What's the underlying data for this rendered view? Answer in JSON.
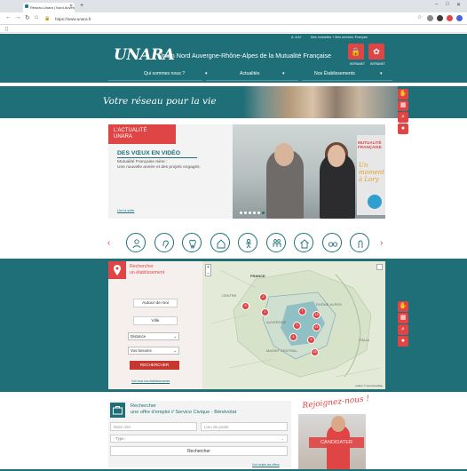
{
  "browser": {
    "tab_title": "Réseau Unara | Nord Auvergne",
    "url": "https://www.unara.fr",
    "nav_icons": [
      "back-arrow-icon",
      "forward-arrow-icon",
      "reload-icon",
      "home-icon"
    ],
    "window_controls": [
      "–",
      "□",
      "✕"
    ]
  },
  "header": {
    "toplinks": [
      "A- A A+",
      "Mes mutuelles + Mes services +",
      "Français"
    ],
    "logo": "UNARA",
    "title": "Union Nord Auvergne-Rhône-Alpes de la Mutualité Française",
    "buttons": [
      {
        "icon": "lock-icon",
        "label": "INTRANET"
      },
      {
        "icon": "network-icon",
        "label": "INTRANET"
      }
    ],
    "menu": [
      "Qui sommes nous ?",
      "Actualités",
      "Nos Établissements"
    ],
    "accent": "#e04545",
    "brand": "#1f6f78"
  },
  "hero": {
    "slogan": "Votre réseau pour la vie"
  },
  "side_toolbar": [
    "handshake-icon",
    "building-icon",
    "search-icon",
    "location-pin-icon"
  ],
  "news": {
    "tag_line1": "L'ACTUALITÉ",
    "tag_line2": "UNARA",
    "headline": "DES VŒUX EN VIDÉO",
    "text_line1": "Mutualité Française Isère :",
    "text_line2": "Une nouvelle année et des projets engagés.",
    "link": "Lire la suite",
    "poster_title": "MUTUALITÉ FRANÇAISE",
    "poster_script": "Un moment à Lory",
    "slides": 6
  },
  "categories": [
    {
      "icon": "care-icon"
    },
    {
      "icon": "hearing-icon"
    },
    {
      "icon": "dental-icon"
    },
    {
      "icon": "home-care-icon"
    },
    {
      "icon": "child-icon"
    },
    {
      "icon": "family-icon"
    },
    {
      "icon": "house-icon"
    },
    {
      "icon": "optical-icon"
    },
    {
      "icon": "hook-icon"
    }
  ],
  "finder": {
    "title_line1": "Rechercher",
    "title_line2": "un établissement",
    "around_me": "Autour de moi",
    "city": "Ville",
    "distance": "Distance",
    "needs": "Vos besoins",
    "search": "RECHERCHER",
    "all_link": "Voir tous nos établissements"
  },
  "map": {
    "labels": [
      "FRANCE",
      "CENTRE",
      "AUVERGNE",
      "RHÔNE-ALPES",
      "MASSIF CENTRAL",
      "ITALIA"
    ],
    "clusters": [
      "6",
      "2",
      "1",
      "7",
      "3",
      "13",
      "14",
      "4",
      "9",
      "15"
    ],
    "zoom": [
      "+",
      "−"
    ],
    "credit": "Leaflet | © OpenStreetMap"
  },
  "jobs": {
    "title_line1": "Rechercher",
    "title_line2": "une offre d'emploi // Service Civique - Bénévolat",
    "keywords_placeholder": "Mots clés",
    "place_placeholder": "Lieu de poste",
    "type_placeholder": "- Type -",
    "search": "Rechercher",
    "all_link": "Voir toutes les offres"
  },
  "join": {
    "title": "Rejoignez-nous !",
    "cta": "CANDIDATER"
  }
}
